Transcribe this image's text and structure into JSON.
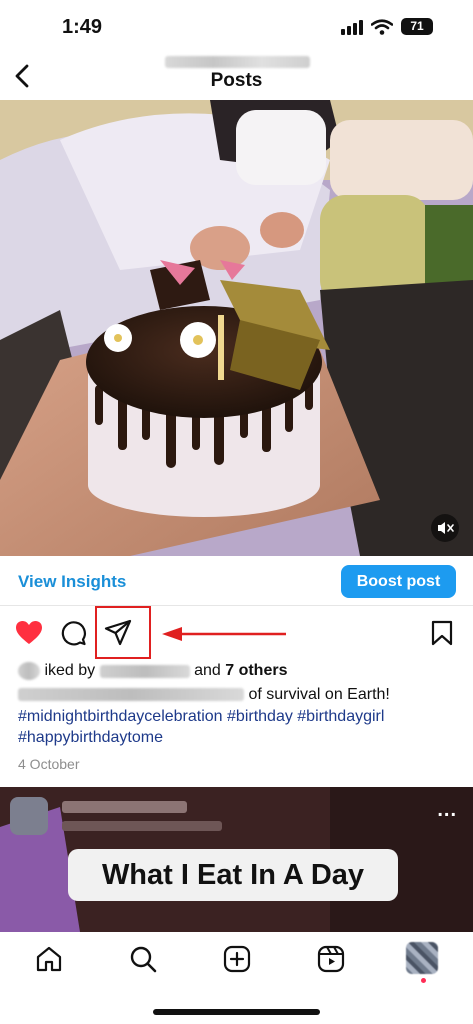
{
  "status_bar": {
    "time": "1:49",
    "battery": "71"
  },
  "header": {
    "title": "Posts",
    "back_icon": "chevron-left-icon"
  },
  "post": {
    "insights_label": "View Insights",
    "boost_label": "Boost post",
    "likes": {
      "prefix": "iked by",
      "middle": "and",
      "others": "7 others"
    },
    "caption_tail": "of survival on Earth!",
    "hashtags_line1": "#midnightbirthdaycelebration #birthday #birthdaygirl",
    "hashtags_line2": "#happybirthdaytome",
    "date": "4 October"
  },
  "next_post": {
    "overlay_title": "What I Eat In A Day",
    "more": "..."
  },
  "colors": {
    "link_blue": "#1a8fd8",
    "boost_blue": "#1d9bf0",
    "like_red": "#ff3040",
    "highlight_red": "#e02020",
    "hashtag_navy": "#1e3a8a"
  },
  "icons": [
    "chevron-left-icon",
    "speaker-muted-icon",
    "heart-filled-icon",
    "comment-icon",
    "send-icon",
    "bookmark-icon",
    "home-icon",
    "search-icon",
    "create-plus-icon",
    "reels-icon"
  ]
}
